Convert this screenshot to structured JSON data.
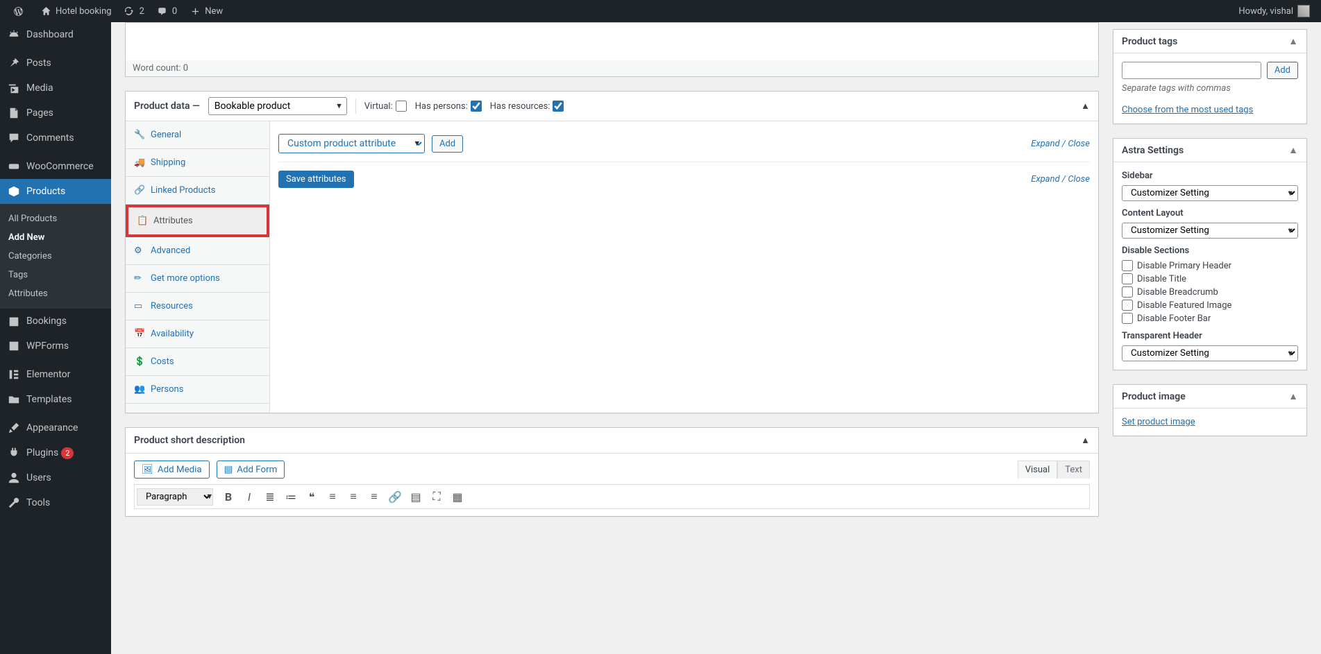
{
  "adminbar": {
    "site_name": "Hotel booking",
    "updates_count": "2",
    "comments_count": "0",
    "new_label": "New",
    "howdy": "Howdy, vishal"
  },
  "sidemenu": {
    "items": [
      {
        "label": "Dashboard",
        "icon": "dash"
      },
      {
        "sep": true
      },
      {
        "label": "Posts",
        "icon": "pin"
      },
      {
        "label": "Media",
        "icon": "media"
      },
      {
        "label": "Pages",
        "icon": "page"
      },
      {
        "label": "Comments",
        "icon": "comment"
      },
      {
        "sep": true
      },
      {
        "label": "WooCommerce",
        "icon": "woo"
      },
      {
        "label": "Products",
        "icon": "products",
        "current": true,
        "submenu": [
          "All Products",
          "Add New",
          "Categories",
          "Tags",
          "Attributes"
        ],
        "sub_current": 1
      },
      {
        "label": "Bookings",
        "icon": "cal"
      },
      {
        "label": "WPForms",
        "icon": "forms"
      },
      {
        "sep": true
      },
      {
        "label": "Elementor",
        "icon": "el"
      },
      {
        "label": "Templates",
        "icon": "folder"
      },
      {
        "sep": true
      },
      {
        "label": "Appearance",
        "icon": "brush"
      },
      {
        "label": "Plugins",
        "icon": "plug",
        "badge": "2"
      },
      {
        "label": "Users",
        "icon": "user"
      },
      {
        "label": "Tools",
        "icon": "wrench"
      }
    ]
  },
  "wordcount": {
    "label": "Word count: 0"
  },
  "product_data": {
    "heading": "Product data —",
    "type_options": [
      "Bookable product"
    ],
    "type_selected": "Bookable product",
    "virtual_label": "Virtual:",
    "persons_label": "Has persons:",
    "resources_label": "Has resources:",
    "tabs": [
      {
        "label": "General",
        "icon": "🔧"
      },
      {
        "label": "Shipping",
        "icon": "🚚"
      },
      {
        "label": "Linked Products",
        "icon": "🔗"
      },
      {
        "label": "Attributes",
        "icon": "📋",
        "highlight": true
      },
      {
        "label": "Advanced",
        "icon": "⚙"
      },
      {
        "label": "Get more options",
        "icon": "✏"
      },
      {
        "label": "Resources",
        "icon": "▭"
      },
      {
        "label": "Availability",
        "icon": "📅"
      },
      {
        "label": "Costs",
        "icon": "💲"
      },
      {
        "label": "Persons",
        "icon": "👥"
      }
    ],
    "attr_select": "Custom product attribute",
    "add_btn": "Add",
    "save_btn": "Save attributes",
    "expand_close": "Expand / Close"
  },
  "short_desc": {
    "heading": "Product short description",
    "add_media": "Add Media",
    "add_form": "Add Form",
    "visual": "Visual",
    "text": "Text",
    "paragraph": "Paragraph"
  },
  "tags_box": {
    "heading": "Product tags",
    "add": "Add",
    "help": "Separate tags with commas",
    "choose": "Choose from the most used tags"
  },
  "astra": {
    "heading": "Astra Settings",
    "sidebar_label": "Sidebar",
    "content_label": "Content Layout",
    "disable_label": "Disable Sections",
    "th_label": "Transparent Header",
    "option": "Customizer Setting",
    "checks": [
      "Disable Primary Header",
      "Disable Title",
      "Disable Breadcrumb",
      "Disable Featured Image",
      "Disable Footer Bar"
    ]
  },
  "image_box": {
    "heading": "Product image",
    "set": "Set product image"
  }
}
